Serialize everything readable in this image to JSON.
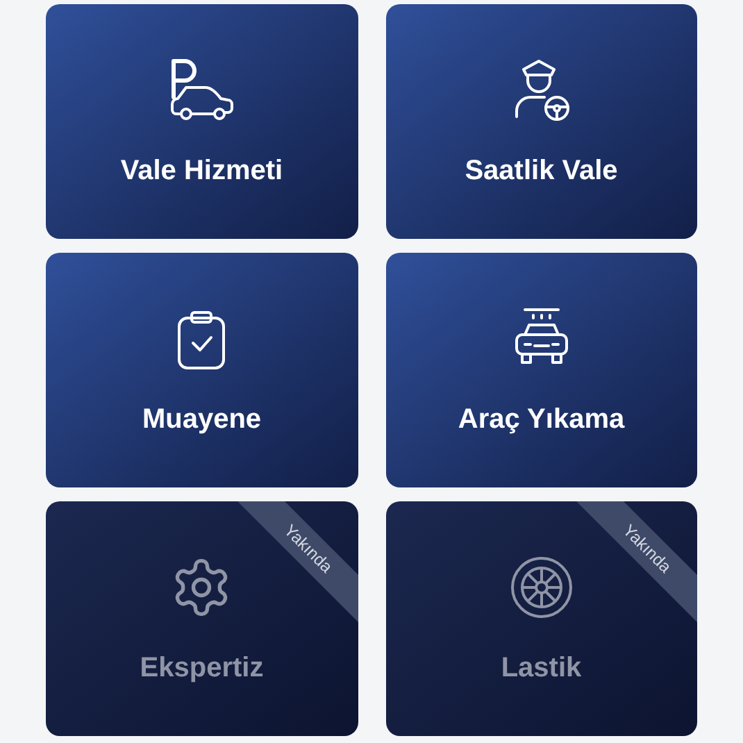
{
  "services": [
    {
      "label": "Vale Hizmeti",
      "disabled": false
    },
    {
      "label": "Saatlik Vale",
      "disabled": false
    },
    {
      "label": "Muayene",
      "disabled": false
    },
    {
      "label": "Araç Yıkama",
      "disabled": false
    },
    {
      "label": "Ekspertiz",
      "disabled": true,
      "badge": "Yakında"
    },
    {
      "label": "Lastik",
      "disabled": true,
      "badge": "Yakında"
    }
  ]
}
